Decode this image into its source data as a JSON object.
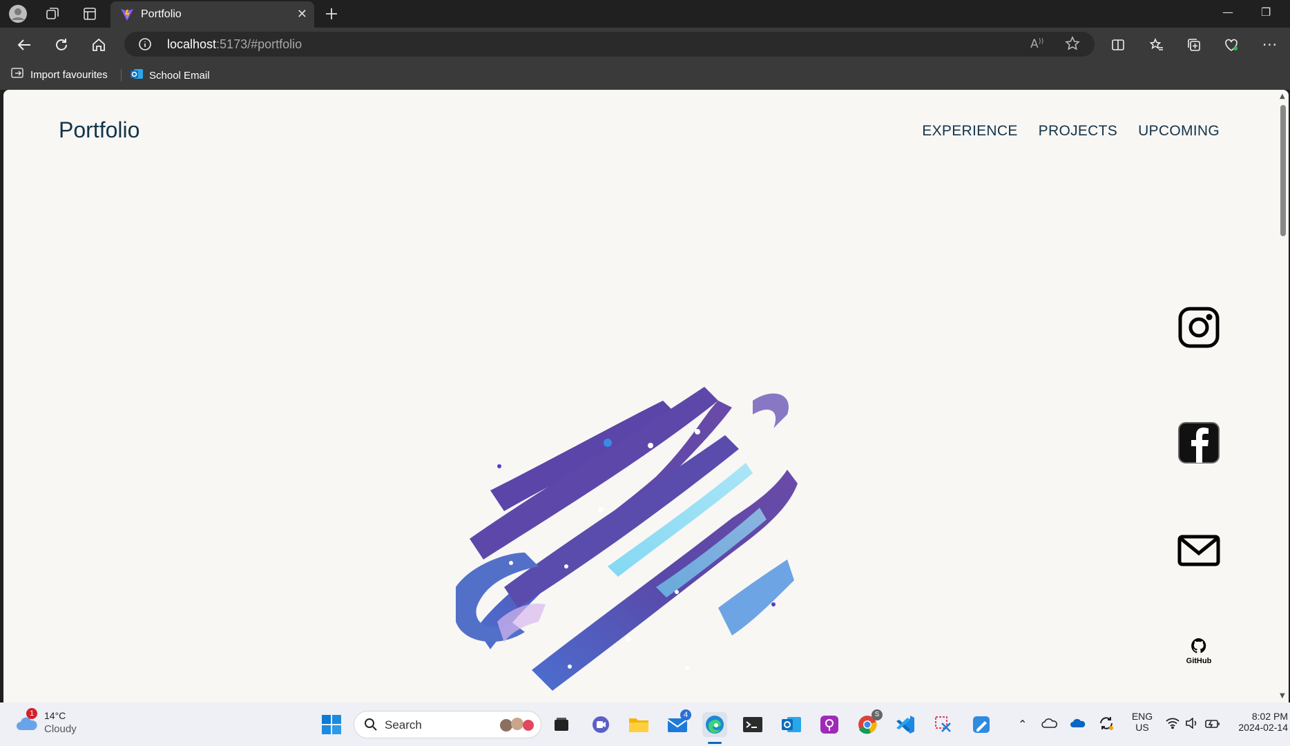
{
  "browser": {
    "tab_title": "Portfolio",
    "url_host": "localhost",
    "url_rest": ":5173/#portfolio",
    "bookmarks": [
      {
        "label": "Import favourites"
      },
      {
        "label": "School Email"
      }
    ]
  },
  "page": {
    "site_title": "Portfolio",
    "nav": [
      "EXPERIENCE",
      "PROJECTS",
      "UPCOMING"
    ],
    "social": [
      {
        "name": "instagram"
      },
      {
        "name": "facebook"
      },
      {
        "name": "email"
      },
      {
        "name": "github",
        "label": "GitHub"
      }
    ]
  },
  "taskbar": {
    "weather_temp": "14°C",
    "weather_desc": "Cloudy",
    "weather_badge": "1",
    "search_placeholder": "Search",
    "mail_badge": "4",
    "chrome_badge": "S",
    "lang_line1": "ENG",
    "lang_line2": "US",
    "time": "8:02 PM",
    "date": "2024-02-14"
  },
  "colors": {
    "page_bg": "#f8f7f4",
    "nav_text": "#14344a",
    "brush_purple": "#5b45a8",
    "brush_blue": "#4a6fd0",
    "brush_cyan": "#6cc7ef"
  }
}
